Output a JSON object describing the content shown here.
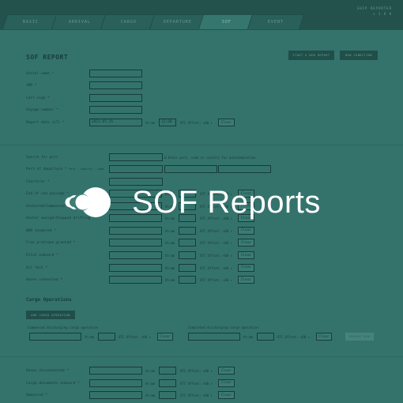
{
  "header": {
    "tabs": [
      "BASIC",
      "ARRIVAL",
      "CARGO",
      "DEPARTURE",
      "SOF",
      "EVENT"
    ],
    "active_tab": "SOF",
    "reporter_title": "SHIP REPORTER",
    "reporter_sub": "v 1 0 0"
  },
  "page": {
    "title": "SOF REPORT",
    "start_new": "START A NEW REPORT",
    "new_condition": "NEW CONDITION"
  },
  "basic_fields": [
    {
      "label": "Vessel name *",
      "value": ""
    },
    {
      "label": "IMO *",
      "value": ""
    },
    {
      "label": "Call sign *",
      "value": ""
    },
    {
      "label": "Voyage number *",
      "value": ""
    }
  ],
  "report_date": {
    "label": "Report date (LT) *",
    "date": "2021-05-26",
    "hh_label": "hh:mm",
    "time": "12:00",
    "utc": "UTC Offset: +00 ▾",
    "clear": "Clear"
  },
  "port": {
    "search_label": "Search for port",
    "search_hint": "& Enter port, code or country for autocompletion",
    "departure_label": "Port of departure *",
    "departure_sub": "Port · Country · Code",
    "charterer_label": "Charterer *"
  },
  "events": [
    {
      "label": "End of sea passage *"
    },
    {
      "label": "Anchored/Commenced drifting *"
    },
    {
      "label": "Anchor aweigh/Stopped drifting *"
    },
    {
      "label": "NOR tendered *"
    },
    {
      "label": "Free pratique granted *"
    },
    {
      "label": "Pilot onboard *"
    },
    {
      "label": "All fast *"
    },
    {
      "label": "Hoses connected *"
    }
  ],
  "common": {
    "hh": "hh:mm",
    "utc": "UTC Offset: +00 ▾",
    "clear": "Clear"
  },
  "cargo": {
    "title": "Cargo Operations",
    "add_button": "ADD CARGO OPERATION",
    "commenced_label": "Commenced discharging cargo operation",
    "completed_label": "Completed discharging cargo operation",
    "remove": "REMOVE ROW"
  },
  "events_lower": [
    {
      "label": "Hoses disconnected *"
    },
    {
      "label": "Cargo documents onboard *"
    },
    {
      "label": "Unmoored *"
    }
  ],
  "overlay": {
    "brand_name": "SOF Reports",
    "accent": "#ffffff"
  }
}
